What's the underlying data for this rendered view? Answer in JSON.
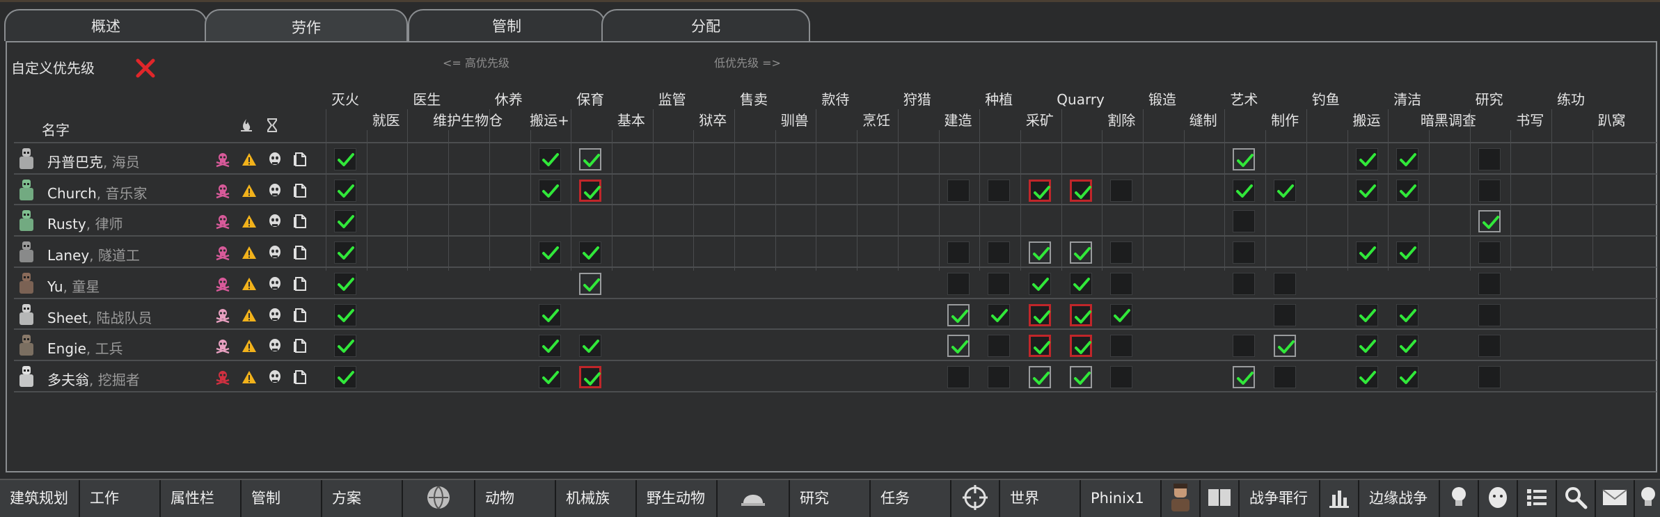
{
  "tabs": [
    {
      "label": "概述",
      "active": false
    },
    {
      "label": "劳作",
      "active": true
    },
    {
      "label": "管制",
      "active": false
    },
    {
      "label": "分配",
      "active": false
    }
  ],
  "header": {
    "custom_priority_label": "自定义优先级",
    "high_priority_hint": "<= 高优先级",
    "low_priority_hint": "低优先级 =>",
    "name_label": "名字"
  },
  "work_columns": [
    "灭火",
    "就医",
    "医生",
    "维护生物仓",
    "休养",
    "搬运+",
    "保育",
    "基本",
    "监管",
    "狱卒",
    "售卖",
    "驯兽",
    "款待",
    "烹饪",
    "狩猎",
    "建造",
    "种植",
    "采矿",
    "Quarry",
    "割除",
    "锻造",
    "缝制",
    "艺术",
    "制作",
    "钓鱼",
    "搬运",
    "清洁",
    "暗黑调查",
    "研究",
    "书写",
    "练功",
    "趴窝"
  ],
  "colonists": [
    {
      "name": "丹普巴克",
      "role": "海员",
      "skull_color": "#d85a9a",
      "avatar_color": "#bdbdbd",
      "cells": {
        "0": "c",
        "5": "c",
        "6": "cf",
        "22": "cf",
        "25": "c",
        "26": "c",
        "28": "e"
      }
    },
    {
      "name": "Church",
      "role": "音乐家",
      "skull_color": "#d85a9a",
      "avatar_color": "#7fbf8f",
      "cells": {
        "0": "c",
        "5": "c",
        "6": "ch",
        "15": "e",
        "16": "e",
        "17": "ch",
        "18": "ch",
        "19": "e",
        "22": "c",
        "23": "c",
        "25": "c",
        "26": "c",
        "28": "e"
      }
    },
    {
      "name": "Rusty",
      "role": "律师",
      "skull_color": "#d85a9a",
      "avatar_color": "#7fbf8f",
      "cells": {
        "0": "c",
        "22": "e",
        "28": "cf"
      }
    },
    {
      "name": "Laney",
      "role": "隧道工",
      "skull_color": "#d85a9a",
      "avatar_color": "#9a9a9a",
      "cells": {
        "0": "c",
        "5": "c",
        "6": "c",
        "15": "e",
        "16": "e",
        "17": "cf",
        "18": "cf",
        "19": "e",
        "22": "e",
        "25": "c",
        "26": "c",
        "28": "e"
      }
    },
    {
      "name": "Yu",
      "role": "童星",
      "skull_color": "#d85a9a",
      "avatar_color": "#8a6b5a",
      "cells": {
        "0": "c",
        "6": "cf",
        "15": "e",
        "16": "e",
        "17": "c",
        "18": "c",
        "19": "e",
        "22": "e",
        "23": "e",
        "28": "e"
      }
    },
    {
      "name": "Sheet",
      "role": "陆战队员",
      "skull_color": "#e8a0c0",
      "avatar_color": "#cfcfcf",
      "cells": {
        "0": "c",
        "5": "c",
        "15": "cf",
        "16": "c",
        "17": "ch",
        "18": "ch",
        "19": "c",
        "23": "e",
        "25": "c",
        "26": "c",
        "28": "e"
      }
    },
    {
      "name": "Engie",
      "role": "工兵",
      "skull_color": "#e8a0c0",
      "avatar_color": "#8a7a6a",
      "cells": {
        "0": "c",
        "5": "c",
        "6": "c",
        "15": "cf",
        "16": "e",
        "17": "ch",
        "18": "ch",
        "19": "e",
        "22": "e",
        "23": "cf",
        "25": "c",
        "26": "c",
        "28": "e"
      }
    },
    {
      "name": "多夫翁",
      "role": "挖掘者",
      "skull_color": "#d03040",
      "avatar_color": "#e0e0e0",
      "cells": {
        "0": "c",
        "5": "c",
        "6": "ch",
        "15": "e",
        "16": "e",
        "17": "cf",
        "18": "cf",
        "19": "e",
        "22": "cf",
        "23": "e",
        "25": "c",
        "26": "c",
        "28": "e"
      }
    }
  ],
  "bottom_bar": [
    {
      "label": "建筑规划",
      "icon": ""
    },
    {
      "label": "工作",
      "icon": ""
    },
    {
      "label": "属性栏",
      "icon": ""
    },
    {
      "label": "管制",
      "icon": ""
    },
    {
      "label": "方案",
      "icon": ""
    },
    {
      "label": "",
      "icon": "globe-icon"
    },
    {
      "label": "动物",
      "icon": ""
    },
    {
      "label": "机械族",
      "icon": ""
    },
    {
      "label": "野生动物",
      "icon": ""
    },
    {
      "label": "",
      "icon": "helmet-icon"
    },
    {
      "label": "研究",
      "icon": ""
    },
    {
      "label": "任务",
      "icon": ""
    },
    {
      "label": "",
      "icon": "crosshair-icon"
    },
    {
      "label": "世界",
      "icon": ""
    },
    {
      "label": "Phinix1",
      "icon": ""
    },
    {
      "label": "",
      "icon": "portrait-icon"
    },
    {
      "label": "",
      "icon": "book-icon"
    },
    {
      "label": "战争罪行",
      "icon": ""
    },
    {
      "label": "",
      "icon": "chart-icon"
    },
    {
      "label": "边缘战争",
      "icon": ""
    },
    {
      "label": "",
      "icon": "lightbulb-icon"
    },
    {
      "label": "",
      "icon": "face-icon"
    },
    {
      "label": "",
      "icon": "list-icon"
    },
    {
      "label": "",
      "icon": "magnifier-icon"
    },
    {
      "label": "",
      "icon": "mail-icon"
    },
    {
      "label": "",
      "icon": "info-icon"
    }
  ],
  "colors": {
    "check_green": "#31e83a",
    "highlight_red": "#c0262a",
    "warning_orange": "#f2b21b"
  }
}
